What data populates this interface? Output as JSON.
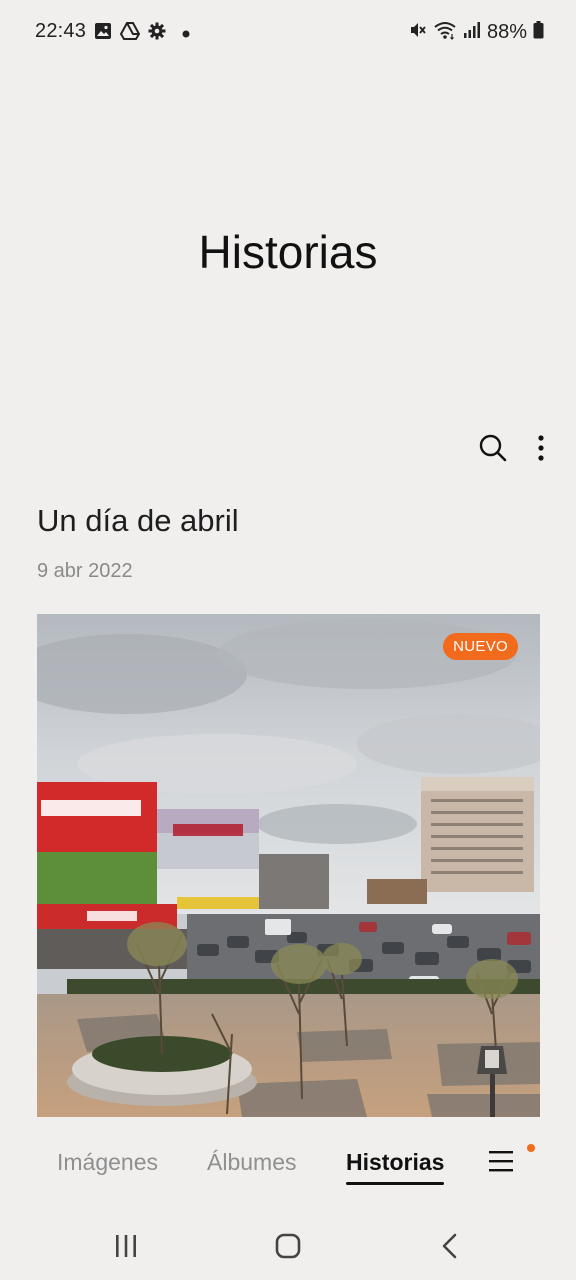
{
  "status_bar": {
    "time": "22:43",
    "battery": "88%",
    "left_icons": [
      "image-icon",
      "drive-icon",
      "gear-icon",
      "dot-icon"
    ],
    "right_icons": [
      "mute-icon",
      "wifi-icon",
      "signal-icon",
      "battery-icon"
    ]
  },
  "header": {
    "title": "Historias"
  },
  "toolbar": {
    "icons": [
      "search-icon",
      "more-vert-icon"
    ]
  },
  "story": {
    "title": "Un día de abril",
    "date": "9 abr 2022",
    "badge": "NUEVO"
  },
  "bottom_tabs": {
    "items": [
      {
        "label": "Imágenes",
        "active": false
      },
      {
        "label": "Álbumes",
        "active": false
      },
      {
        "label": "Historias",
        "active": true
      }
    ],
    "menu_icon": "hamburger-icon",
    "notification_color": "#f26a1b"
  },
  "nav_bar": {
    "icons": [
      "recents-icon",
      "home-icon",
      "back-icon"
    ]
  },
  "colors": {
    "background": "#f0efee",
    "accent": "#f26a1b"
  }
}
